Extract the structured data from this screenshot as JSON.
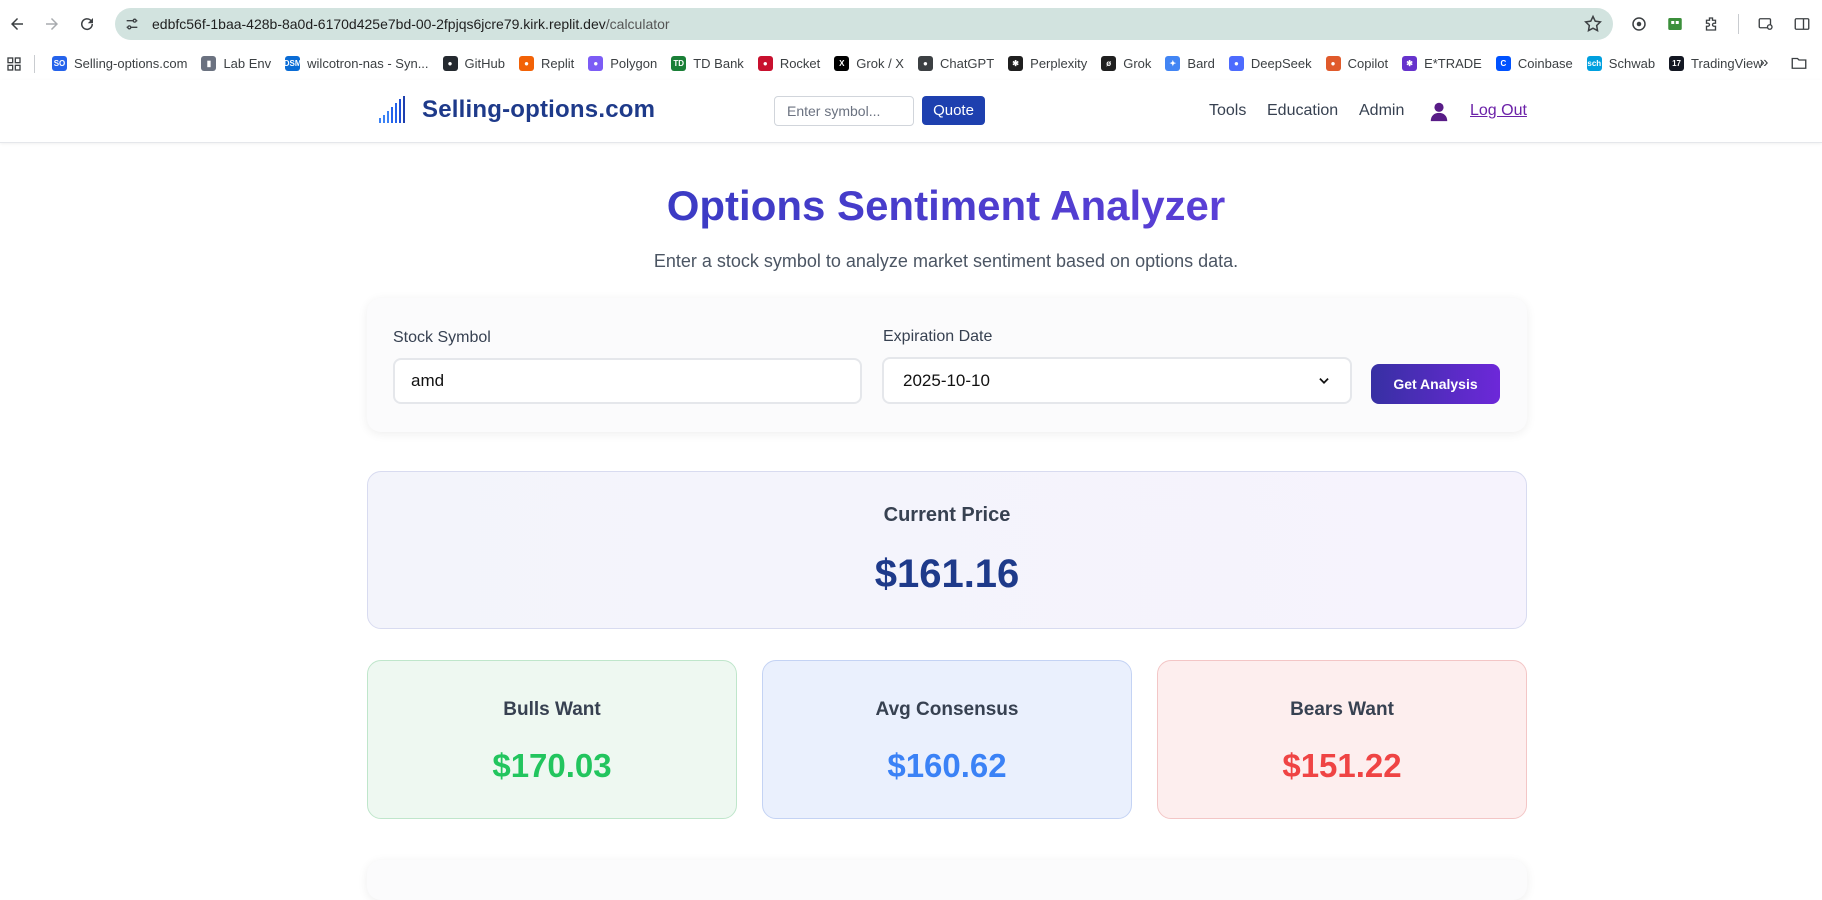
{
  "browser": {
    "url_host": "edbfc56f-1baa-428b-8a0d-6170d425e7bd-00-2fpjqs6jcre79.kirk.replit.dev",
    "url_path": "/calculator",
    "bookmarks": [
      {
        "label": "Selling-options.com",
        "color": "#2563eb",
        "icon": "SO"
      },
      {
        "label": "Lab Env",
        "color": "#6b7280",
        "icon": "▮"
      },
      {
        "label": "wilcotron-nas - Syn...",
        "color": "#0a6cd5",
        "icon": "DSM"
      },
      {
        "label": "GitHub",
        "color": "#24292f",
        "icon": "●"
      },
      {
        "label": "Replit",
        "color": "#f26207",
        "icon": "●"
      },
      {
        "label": "Polygon",
        "color": "#7c5cf5",
        "icon": "●"
      },
      {
        "label": "TD Bank",
        "color": "#1a7f37",
        "icon": "TD"
      },
      {
        "label": "Rocket",
        "color": "#c8102e",
        "icon": "●"
      },
      {
        "label": "Grok / X",
        "color": "#000000",
        "icon": "X"
      },
      {
        "label": "ChatGPT",
        "color": "#3c4043",
        "icon": "●"
      },
      {
        "label": "Perplexity",
        "color": "#1f1f1f",
        "icon": "✱"
      },
      {
        "label": "Grok",
        "color": "#1f1f1f",
        "icon": "ø"
      },
      {
        "label": "Bard",
        "color": "#4285f4",
        "icon": "✦"
      },
      {
        "label": "DeepSeek",
        "color": "#4d6bfe",
        "icon": "●"
      },
      {
        "label": "Copilot",
        "color": "#e05a2b",
        "icon": "●"
      },
      {
        "label": "E*TRADE",
        "color": "#6633cc",
        "icon": "✱"
      },
      {
        "label": "Coinbase",
        "color": "#0052ff",
        "icon": "C"
      },
      {
        "label": "Schwab",
        "color": "#00a0df",
        "icon": "sch"
      },
      {
        "label": "TradingView",
        "color": "#131722",
        "icon": "17"
      }
    ]
  },
  "header": {
    "brand": "Selling-options.com",
    "search_placeholder": "Enter symbol...",
    "quote_label": "Quote",
    "nav": {
      "tools": "Tools",
      "education": "Education",
      "admin": "Admin"
    },
    "logout_label": "Log Out"
  },
  "main": {
    "title": "Options Sentiment Analyzer",
    "subtitle": "Enter a stock symbol to analyze market sentiment based on options data.",
    "form": {
      "symbol_label": "Stock Symbol",
      "symbol_value": "amd",
      "expiration_label": "Expiration Date",
      "expiration_value": "2025-10-10",
      "button_label": "Get Analysis"
    },
    "current_price": {
      "label": "Current Price",
      "value": "$161.16"
    },
    "stats": {
      "bulls": {
        "label": "Bulls Want",
        "value": "$170.03",
        "color": "#22c55e"
      },
      "avg": {
        "label": "Avg Consensus",
        "value": "$160.62",
        "color": "#3b82f6"
      },
      "bears": {
        "label": "Bears Want",
        "value": "$151.22",
        "color": "#ef4444"
      }
    }
  }
}
